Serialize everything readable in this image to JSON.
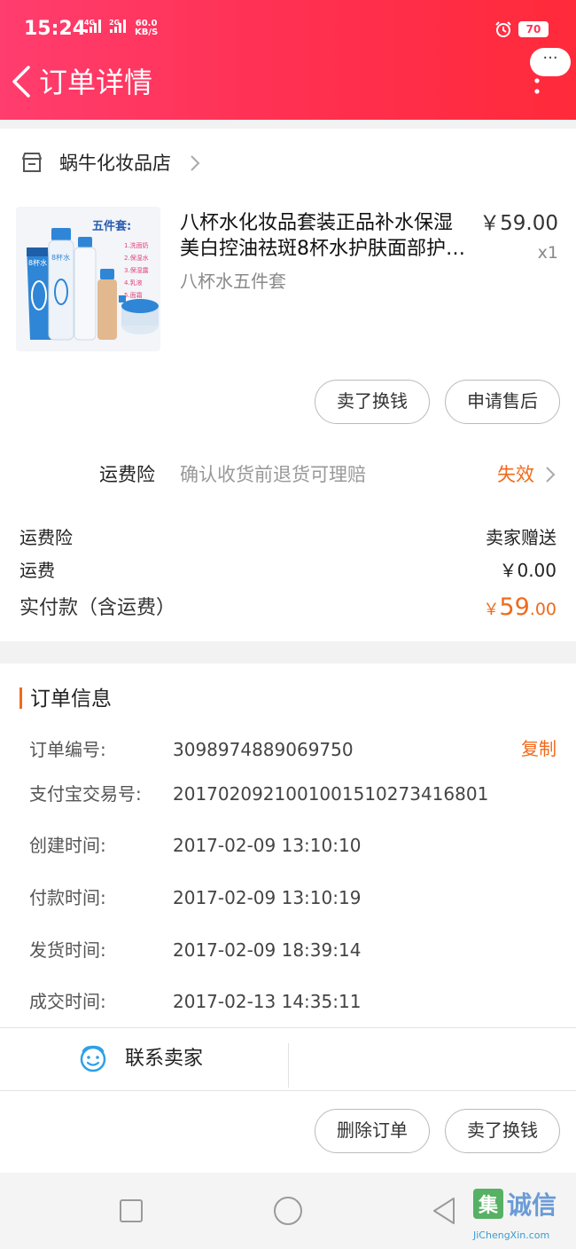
{
  "status_bar": {
    "time": "15:24",
    "network_4g": "4G",
    "network_2g": "2G",
    "speed_value": "60.0",
    "speed_unit": "KB/S",
    "battery": "70"
  },
  "header": {
    "title": "订单详情",
    "more_bubble": "···"
  },
  "shop": {
    "name": "蜗牛化妆品店"
  },
  "product": {
    "title_line1": "八杯水化妆品套装正品补水保湿",
    "title_line2": "美白控油祛斑8杯水护肤面部护…",
    "sku": "八杯水五件套",
    "price": "￥59.00",
    "quantity": "x1",
    "image_text": {
      "set_label": "五件套:",
      "brand": "8杯水",
      "items": [
        "1.洗面奶",
        "2.保湿水",
        "3.保湿露",
        "4.乳液",
        "5.面霜"
      ]
    }
  },
  "item_actions": {
    "sell_label": "卖了换钱",
    "aftersale_label": "申请售后"
  },
  "insurance": {
    "label": "运费险",
    "description": "确认收货前退货可理赔",
    "status": "失效"
  },
  "summary": {
    "insurance_label": "运费险",
    "insurance_value": "卖家赠送",
    "shipping_label": "运费",
    "shipping_value": "￥0.00",
    "paid_label": "实付款（含运费）",
    "paid_currency": "￥",
    "paid_integer": "59",
    "paid_decimal": ".00"
  },
  "order_info": {
    "title": "订单信息",
    "copy_label": "复制",
    "rows": [
      {
        "label": "订单编号:",
        "value": "3098974889069750"
      },
      {
        "label": "支付宝交易号:",
        "value": "2017020921001001510273416801"
      },
      {
        "label": "创建时间:",
        "value": "2017-02-09 13:10:10"
      },
      {
        "label": "付款时间:",
        "value": "2017-02-09 13:10:19"
      },
      {
        "label": "发货时间:",
        "value": "2017-02-09 18:39:14"
      },
      {
        "label": "成交时间:",
        "value": "2017-02-13 14:35:11"
      }
    ]
  },
  "contact": {
    "label": "联系卖家"
  },
  "bottom_actions": {
    "delete_label": "删除订单",
    "sell_label": "卖了换钱"
  },
  "watermark": {
    "text": "集诚信",
    "domain": "JiChengXin.com"
  },
  "colors": {
    "header_start": "#ff3d6e",
    "header_end": "#ff2a3a",
    "accent_orange": "#f06a1a",
    "contact_blue": "#2ea0e8"
  },
  "icons": {
    "back": "chevron-left-icon",
    "more": "more-vertical-icon",
    "shop": "store-icon",
    "contact": "chat-face-icon"
  }
}
